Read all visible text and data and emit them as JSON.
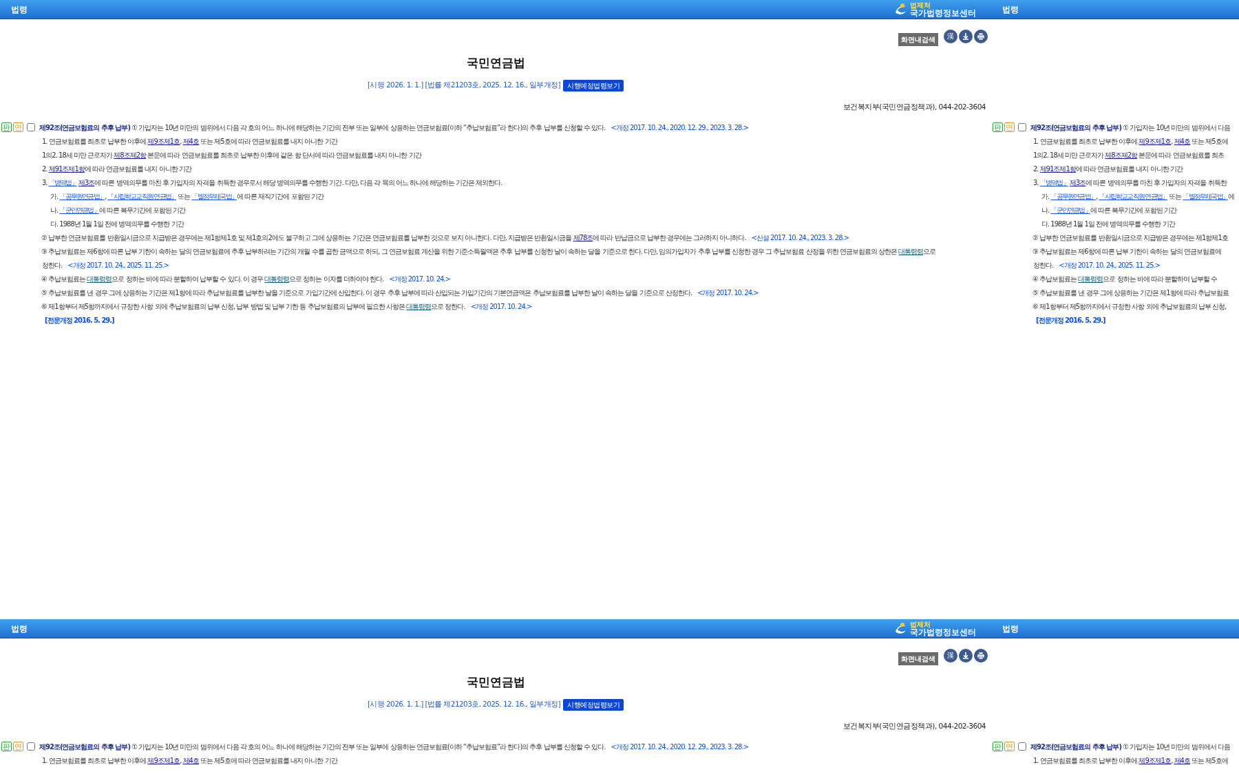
{
  "tiles": [
    {
      "header": {
        "left": "법령",
        "logo": {
          "small": "법제처",
          "name": "국가법령정보센터"
        }
      },
      "toolbar": {
        "search": "화면내검색",
        "icons": [
          {
            "kind": "hanja",
            "text": "漢"
          },
          {
            "kind": "download"
          },
          {
            "kind": "print"
          }
        ]
      },
      "title": "국민연금법",
      "info": "[시행 2026. 1. 1.] [법률 제21203호, 2025. 12. 16., 일부개정]",
      "future_button": "시행예정법령보기",
      "ministry": "보건복지부(국민연금정책과), 044-202-3604",
      "article": {
        "badges": [
          {
            "text": "판",
            "color": "#2e9e3e"
          },
          {
            "text": "연",
            "color": "#e09a1a"
          }
        ],
        "checked": false,
        "lines": [
          {
            "kind": "heading",
            "segments": [
              {
                "text": "제92조(연금보험료의 추후 납부)",
                "kind": "bold"
              },
              {
                "text": " ① 가입자는 10년 미만의 범위에서 다음 각 호의 어느 하나에 해당하는 기간의 전부 또는 일부에 상응하는 연금보험료(이하 “추납보험료”라 한다)의 추후 납부를 신청할 수 있다.",
                "kind": "plain"
              },
              {
                "text": "<개정 2017. 10. 24., 2020. 12. 29., 2023. 3. 28.>",
                "kind": "amend"
              }
            ]
          },
          {
            "kind": "item",
            "segments": [
              {
                "text": "1. 연금보험료를 최초로 납부한 이후에 ",
                "kind": "plain"
              },
              {
                "text": "제9조제1호",
                "kind": "ref"
              },
              {
                "text": ", ",
                "kind": "plain"
              },
              {
                "text": "제4호",
                "kind": "ref"
              },
              {
                "text": " 또는 제5호에 따라 연금보험료를 내지 아니한 기간",
                "kind": "plain"
              }
            ]
          },
          {
            "kind": "item",
            "segments": [
              {
                "text": "1의2. 18세 미만 근로자가 ",
                "kind": "plain"
              },
              {
                "text": "제8조제2항",
                "kind": "ref"
              },
              {
                "text": " 본문에 따라 연금보험료를 최초로 납부한 이후에 같은 항 단서에 따라 연금보험료를 내지 아니한 기간",
                "kind": "plain"
              }
            ]
          },
          {
            "kind": "item",
            "segments": [
              {
                "text": "2. ",
                "kind": "plain"
              },
              {
                "text": "제91조제1항",
                "kind": "ref"
              },
              {
                "text": "에 따라 연금보험료를 내지 아니한 기간",
                "kind": "plain"
              }
            ]
          },
          {
            "kind": "item",
            "segments": [
              {
                "text": "3. ",
                "kind": "plain"
              },
              {
                "text": "「병역법」",
                "kind": "law"
              },
              {
                "text": "제3조",
                "kind": "ref",
                "space_before": true
              },
              {
                "text": "에 따른 병역의무를 마친 후 가입자의 자격을 취득한 경우로서 해당 병역의무를 수행한 기간. 다만, 다음 각 목의 어느 하나에 해당하는 기간은 제외한다.",
                "kind": "plain"
              }
            ]
          },
          {
            "kind": "sub",
            "segments": [
              {
                "text": "가. ",
                "kind": "plain"
              },
              {
                "text": "「공무원연금법」",
                "kind": "law"
              },
              {
                "text": ", ",
                "kind": "plain"
              },
              {
                "text": "「사립학교교직원 연금법」",
                "kind": "law"
              },
              {
                "text": " 또는 ",
                "kind": "plain"
              },
              {
                "text": "「별정우체국법」",
                "kind": "law"
              },
              {
                "text": "에 따른 재직기간에 포함된 기간",
                "kind": "plain"
              }
            ]
          },
          {
            "kind": "sub",
            "segments": [
              {
                "text": "나. ",
                "kind": "plain"
              },
              {
                "text": "「군인연금법」",
                "kind": "law"
              },
              {
                "text": "에 따른 복무기간에 포함된 기간",
                "kind": "plain"
              }
            ]
          },
          {
            "kind": "sub",
            "segments": [
              {
                "text": "다. 1988년 1월 1일 전에 병역의무를 수행한 기간",
                "kind": "plain"
              }
            ]
          },
          {
            "kind": "para",
            "segments": [
              {
                "text": "② 납부한 연금보험료를 반환일시금으로 지급받은 경우에는 제1항제1호 및 제1호의2에도 불구하고 그에 상응하는 기간은 연금보험료를 납부한 것으로 보지 아니한다. 다만, 지급받은 반환일시금을 ",
                "kind": "plain"
              },
              {
                "text": "제78조",
                "kind": "ref"
              },
              {
                "text": "에 따라 반납금으로 납부한 경우에는 그러하지 아니하다.",
                "kind": "plain"
              },
              {
                "text": "<신설 2017. 10. 24., 2023. 3. 28.>",
                "kind": "amend"
              }
            ]
          },
          {
            "kind": "para",
            "segments": [
              {
                "text": "③ 추납보험료는 제6항에 따른 납부 기한이 속하는 달의 연금보험료에 추후 납부하려는 기간의 개월 수를 곱한 금액으로 하되, 그 연금보험료 계산을 위한 기준소득월액은 추후 납부를 신청한 날이 속하는 달을 기준으로 한다. 다만, 임의가입자가 추후 납부를 신청한 경우 그 추납보험료 산정을 위한 연금보험료의 상한은 ",
                "kind": "plain"
              },
              {
                "text": "대통령령",
                "kind": "decree"
              },
              {
                "text": "으로",
                "kind": "plain"
              }
            ]
          },
          {
            "kind": "cont",
            "segments": [
              {
                "text": "정한다.",
                "kind": "plain"
              },
              {
                "text": "<개정 2017. 10. 24., 2025. 11. 25.>",
                "kind": "amend"
              }
            ]
          },
          {
            "kind": "para",
            "segments": [
              {
                "text": "④ 추납보험료는 ",
                "kind": "plain"
              },
              {
                "text": "대통령령",
                "kind": "decree"
              },
              {
                "text": "으로 정하는 바에 따라 분할하여 납부할 수 있다. 이 경우 ",
                "kind": "plain"
              },
              {
                "text": "대통령령",
                "kind": "decree"
              },
              {
                "text": "으로 정하는 이자를 더하여야 한다.",
                "kind": "plain"
              },
              {
                "text": "<개정 2017. 10. 24.>",
                "kind": "amend"
              }
            ]
          },
          {
            "kind": "para",
            "segments": [
              {
                "text": "⑤ 추납보험료를 낸 경우 그에 상응하는 기간은 제1항에 따라 추납보험료를 납부한 날을 기준으로 가입기간에 산입한다. 이 경우 추후 납부에 따라 산입되는 가입기간의 기본연금액은 추납보험료를 납부한 날이 속하는 달을 기준으로 산정한다.",
                "kind": "plain"
              },
              {
                "text": "<개정 2017. 10. 24.>",
                "kind": "amend"
              }
            ]
          },
          {
            "kind": "para",
            "segments": [
              {
                "text": "⑥ 제1항부터 제5항까지에서 규정한 사항 외에 추납보험료의 납부 신청, 납부 방법 및 납부 기한 등 추납보험료의 납부에 필요한 사항은 ",
                "kind": "plain"
              },
              {
                "text": "대통령령",
                "kind": "decree"
              },
              {
                "text": "으로 정한다.",
                "kind": "plain"
              },
              {
                "text": "<개정 2017. 10. 24.>",
                "kind": "amend"
              }
            ]
          },
          {
            "kind": "note",
            "segments": [
              {
                "text": "[전문개정 2016. 5. 29.]",
                "kind": "note"
              }
            ]
          }
        ]
      }
    },
    {
      "header": {
        "left": "법령"
      },
      "article": {
        "badges": [
          {
            "text": "판",
            "color": "#2e9e3e"
          },
          {
            "text": "연",
            "color": "#e09a1a"
          }
        ],
        "checked": false,
        "lines": [
          {
            "kind": "heading",
            "segments": [
              {
                "text": "제92조(연금보험료의 추후 납부)",
                "kind": "bold"
              },
              {
                "text": " ① 가입자는 10년 미만의 범위에서 다음",
                "kind": "plain"
              }
            ]
          },
          {
            "kind": "item",
            "segments": [
              {
                "text": "1. 연금보험료를 최초로 납부한 이후에 ",
                "kind": "plain"
              },
              {
                "text": "제9조제1호",
                "kind": "ref"
              },
              {
                "text": ", ",
                "kind": "plain"
              },
              {
                "text": "제4호",
                "kind": "ref"
              },
              {
                "text": " 또는 제5호에",
                "kind": "plain"
              }
            ]
          },
          {
            "kind": "item",
            "segments": [
              {
                "text": "1의2. 18세 미만 근로자가 ",
                "kind": "plain"
              },
              {
                "text": "제8조제2항",
                "kind": "ref"
              },
              {
                "text": " 본문에 따라 연금보험료를 최초",
                "kind": "plain"
              }
            ]
          },
          {
            "kind": "item",
            "segments": [
              {
                "text": "2. ",
                "kind": "plain"
              },
              {
                "text": "제91조제1항",
                "kind": "ref"
              },
              {
                "text": "에 따라 연금보험료를 내지 아니한 기간",
                "kind": "plain"
              }
            ]
          },
          {
            "kind": "item",
            "segments": [
              {
                "text": "3. ",
                "kind": "plain"
              },
              {
                "text": "「병역법」",
                "kind": "law"
              },
              {
                "text": "제3조",
                "kind": "ref",
                "space_before": true
              },
              {
                "text": "에 따른 병역의무를 마친 후 가입자의 자격을 취득한",
                "kind": "plain"
              }
            ]
          },
          {
            "kind": "sub",
            "segments": [
              {
                "text": "가. ",
                "kind": "plain"
              },
              {
                "text": "「공무원연금법」",
                "kind": "law"
              },
              {
                "text": ", ",
                "kind": "plain"
              },
              {
                "text": "「사립학교교직원 연금법」",
                "kind": "law"
              },
              {
                "text": " 또는 ",
                "kind": "plain"
              },
              {
                "text": "「별정우체국법」",
                "kind": "law"
              },
              {
                "text": "에",
                "kind": "plain"
              }
            ]
          },
          {
            "kind": "sub",
            "segments": [
              {
                "text": "나. ",
                "kind": "plain"
              },
              {
                "text": "「군인연금법」",
                "kind": "law"
              },
              {
                "text": "에 따른 복무기간에 포함된 기간",
                "kind": "plain"
              }
            ]
          },
          {
            "kind": "sub",
            "segments": [
              {
                "text": "다. 1988년 1월 1일 전에 병역의무를 수행한 기간",
                "kind": "plain"
              }
            ]
          },
          {
            "kind": "para",
            "segments": [
              {
                "text": "② 납부한 연금보험료를 반환일시금으로 지급받은 경우에는 제1항제1호",
                "kind": "plain"
              }
            ]
          },
          {
            "kind": "para",
            "segments": [
              {
                "text": "③ 추납보험료는 제6항에 따른 납부 기한이 속하는 달의 연금보험료에",
                "kind": "plain"
              }
            ]
          },
          {
            "kind": "cont",
            "segments": [
              {
                "text": "정한다.",
                "kind": "plain"
              },
              {
                "text": "<개정 2017. 10. 24., 2025. 11. 25.>",
                "kind": "amend"
              }
            ]
          },
          {
            "kind": "para",
            "segments": [
              {
                "text": "④ 추납보험료는 ",
                "kind": "plain"
              },
              {
                "text": "대통령령",
                "kind": "decree"
              },
              {
                "text": "으로 정하는 바에 따라 분할하여 납부할 수",
                "kind": "plain"
              }
            ]
          },
          {
            "kind": "para",
            "segments": [
              {
                "text": "⑤ 추납보험료를 낸 경우 그에 상응하는 기간은 제1항에 따라 추납보험료",
                "kind": "plain"
              }
            ]
          },
          {
            "kind": "para",
            "segments": [
              {
                "text": "⑥ 제1항부터 제5항까지에서 규정한 사항 외에 추납보험료의 납부 신청,",
                "kind": "plain"
              }
            ]
          },
          {
            "kind": "note",
            "segments": [
              {
                "text": "[전문개정 2016. 5. 29.]",
                "kind": "note"
              }
            ]
          }
        ]
      }
    },
    {
      "header": {
        "left": "법령",
        "logo": {
          "small": "법제처",
          "name": "국가법령정보센터"
        }
      },
      "toolbar": {
        "search": "화면내검색",
        "icons": [
          {
            "kind": "hanja",
            "text": "漢"
          },
          {
            "kind": "download"
          },
          {
            "kind": "print"
          }
        ]
      },
      "title": "국민연금법",
      "info": "[시행 2026. 1. 1.] [법률 제21203호, 2025. 12. 16., 일부개정]",
      "future_button": "시행예정법령보기",
      "ministry": "보건복지부(국민연금정책과), 044-202-3604",
      "article": {
        "badges": [
          {
            "text": "판",
            "color": "#2e9e3e"
          },
          {
            "text": "연",
            "color": "#e09a1a"
          }
        ],
        "checked": false,
        "lines": [
          {
            "kind": "heading",
            "segments": [
              {
                "text": "제92조(연금보험료의 추후 납부)",
                "kind": "bold"
              },
              {
                "text": " ① 가입자는 10년 미만의 범위에서 다음 각 호의 어느 하나에 해당하는 기간의 전부 또는 일부에 상응하는 연금보험료(이하 “추납보험료”라 한다)의 추후 납부를 신청할 수 있다.",
                "kind": "plain"
              },
              {
                "text": "<개정 2017. 10. 24., 2020. 12. 29., 2023. 3. 28.>",
                "kind": "amend"
              }
            ]
          },
          {
            "kind": "item",
            "segments": [
              {
                "text": "1. 연금보험료를 최초로 납부한 이후에 ",
                "kind": "plain"
              },
              {
                "text": "제9조제1호",
                "kind": "ref"
              },
              {
                "text": ", ",
                "kind": "plain"
              },
              {
                "text": "제4호",
                "kind": "ref"
              },
              {
                "text": " 또는 제5호에 따라 연금보험료를 내지 아니한 기간",
                "kind": "plain"
              }
            ]
          }
        ]
      }
    },
    {
      "header": {
        "left": "법령"
      },
      "article": {
        "badges": [
          {
            "text": "판",
            "color": "#2e9e3e"
          },
          {
            "text": "연",
            "color": "#e09a1a"
          }
        ],
        "checked": false,
        "lines": [
          {
            "kind": "heading",
            "segments": [
              {
                "text": "제92조(연금보험료의 추후 납부)",
                "kind": "bold"
              },
              {
                "text": " ① 가입자는 10년 미만의 범위에서 다음",
                "kind": "plain"
              }
            ]
          },
          {
            "kind": "item",
            "segments": [
              {
                "text": "1. 연금보험료를 최초로 납부한 이후에 ",
                "kind": "plain"
              },
              {
                "text": "제9조제1호",
                "kind": "ref"
              },
              {
                "text": ", ",
                "kind": "plain"
              },
              {
                "text": "제4호",
                "kind": "ref"
              },
              {
                "text": " 또는 제5호에",
                "kind": "plain"
              }
            ]
          }
        ]
      }
    }
  ]
}
